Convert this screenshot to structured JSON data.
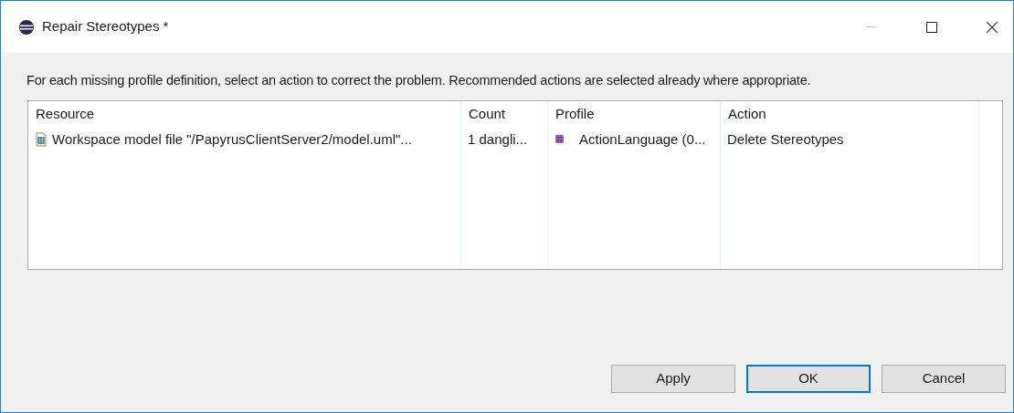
{
  "window": {
    "title": "Repair Stereotypes *"
  },
  "instructions": "For each missing profile definition, select an action to correct the problem. Recommended actions are selected already where appropriate.",
  "table": {
    "columns": [
      "Resource",
      "Count",
      "Profile",
      "Action"
    ],
    "rows": [
      {
        "resource": "Workspace model file \"/PapyrusClientServer2/model.uml\"...",
        "count": "1 dangli...",
        "profile": "ActionLanguage (0...",
        "action": "Delete Stereotypes"
      }
    ]
  },
  "buttons": [
    {
      "label": "Apply",
      "default": false
    },
    {
      "label": "OK",
      "default": true
    },
    {
      "label": "Cancel",
      "default": false
    }
  ]
}
